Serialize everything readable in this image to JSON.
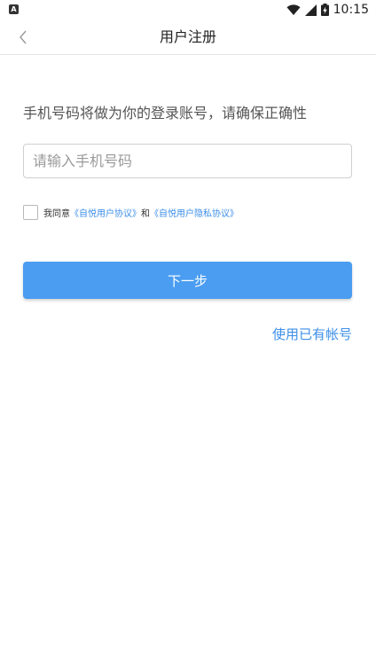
{
  "status_bar": {
    "time": "10:15",
    "left_icon_letter": "A"
  },
  "nav": {
    "title": "用户注册"
  },
  "form": {
    "hint": "手机号码将做为你的登录账号，请确保正确性",
    "phone_placeholder": "请输入手机号码",
    "phone_value": "",
    "agree_prefix": "我同意",
    "link_user_agreement": "《自悦用户协议》",
    "agree_and": "和",
    "link_privacy_agreement": "《自悦用户隐私协议》",
    "next_label": "下一步",
    "existing_account_label": "使用已有帐号"
  },
  "colors": {
    "accent": "#4a9df1",
    "link": "#3d8fe8"
  }
}
